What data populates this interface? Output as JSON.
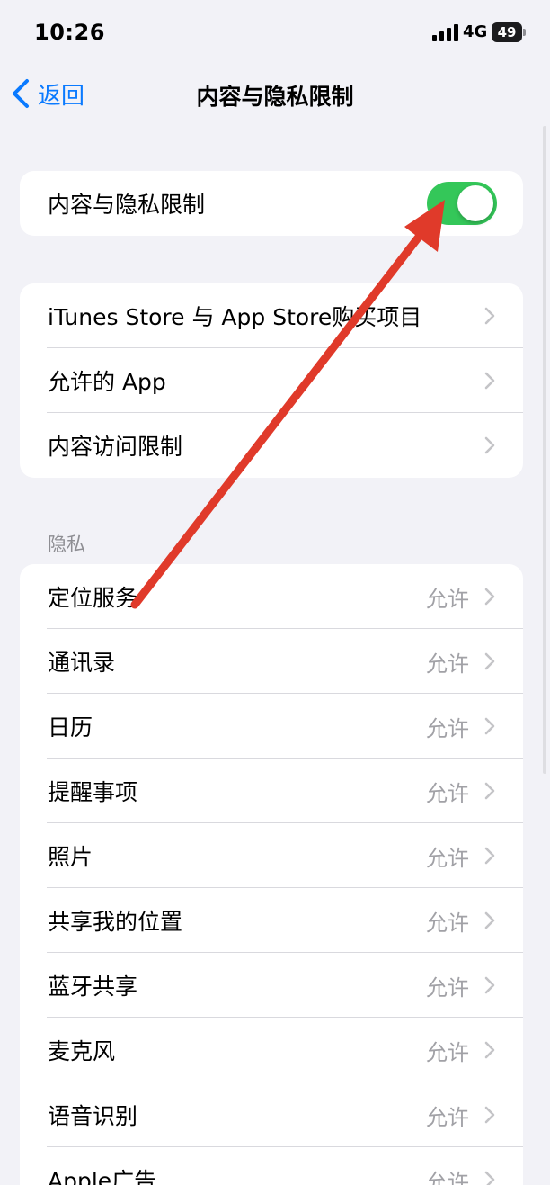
{
  "status_bar": {
    "time": "10:26",
    "network": "4G",
    "battery": "49"
  },
  "nav": {
    "back_label": "返回",
    "title": "内容与隐私限制"
  },
  "master_toggle": {
    "label": "内容与隐私限制",
    "on": true,
    "color": "#34c759"
  },
  "restrictions": [
    {
      "label": "iTunes Store 与 App Store购买项目"
    },
    {
      "label": "允许的 App"
    },
    {
      "label": "内容访问限制"
    }
  ],
  "privacy_section": {
    "header": "隐私",
    "items": [
      {
        "label": "定位服务",
        "value": "允许"
      },
      {
        "label": "通讯录",
        "value": "允许"
      },
      {
        "label": "日历",
        "value": "允许"
      },
      {
        "label": "提醒事项",
        "value": "允许"
      },
      {
        "label": "照片",
        "value": "允许"
      },
      {
        "label": "共享我的位置",
        "value": "允许"
      },
      {
        "label": "蓝牙共享",
        "value": "允许"
      },
      {
        "label": "麦克风",
        "value": "允许"
      },
      {
        "label": "语音识别",
        "value": "允许"
      },
      {
        "label": "Apple广告",
        "value": "允许"
      }
    ]
  },
  "colors": {
    "accent": "#0a7aff",
    "toggle_on": "#34c759",
    "annotation_arrow": "#e03a2a",
    "background": "#f2f2f7"
  },
  "icons": {
    "back": "chevron-left-icon",
    "row": "chevron-right-icon",
    "signal": "cellular-signal-icon",
    "battery": "battery-icon"
  }
}
